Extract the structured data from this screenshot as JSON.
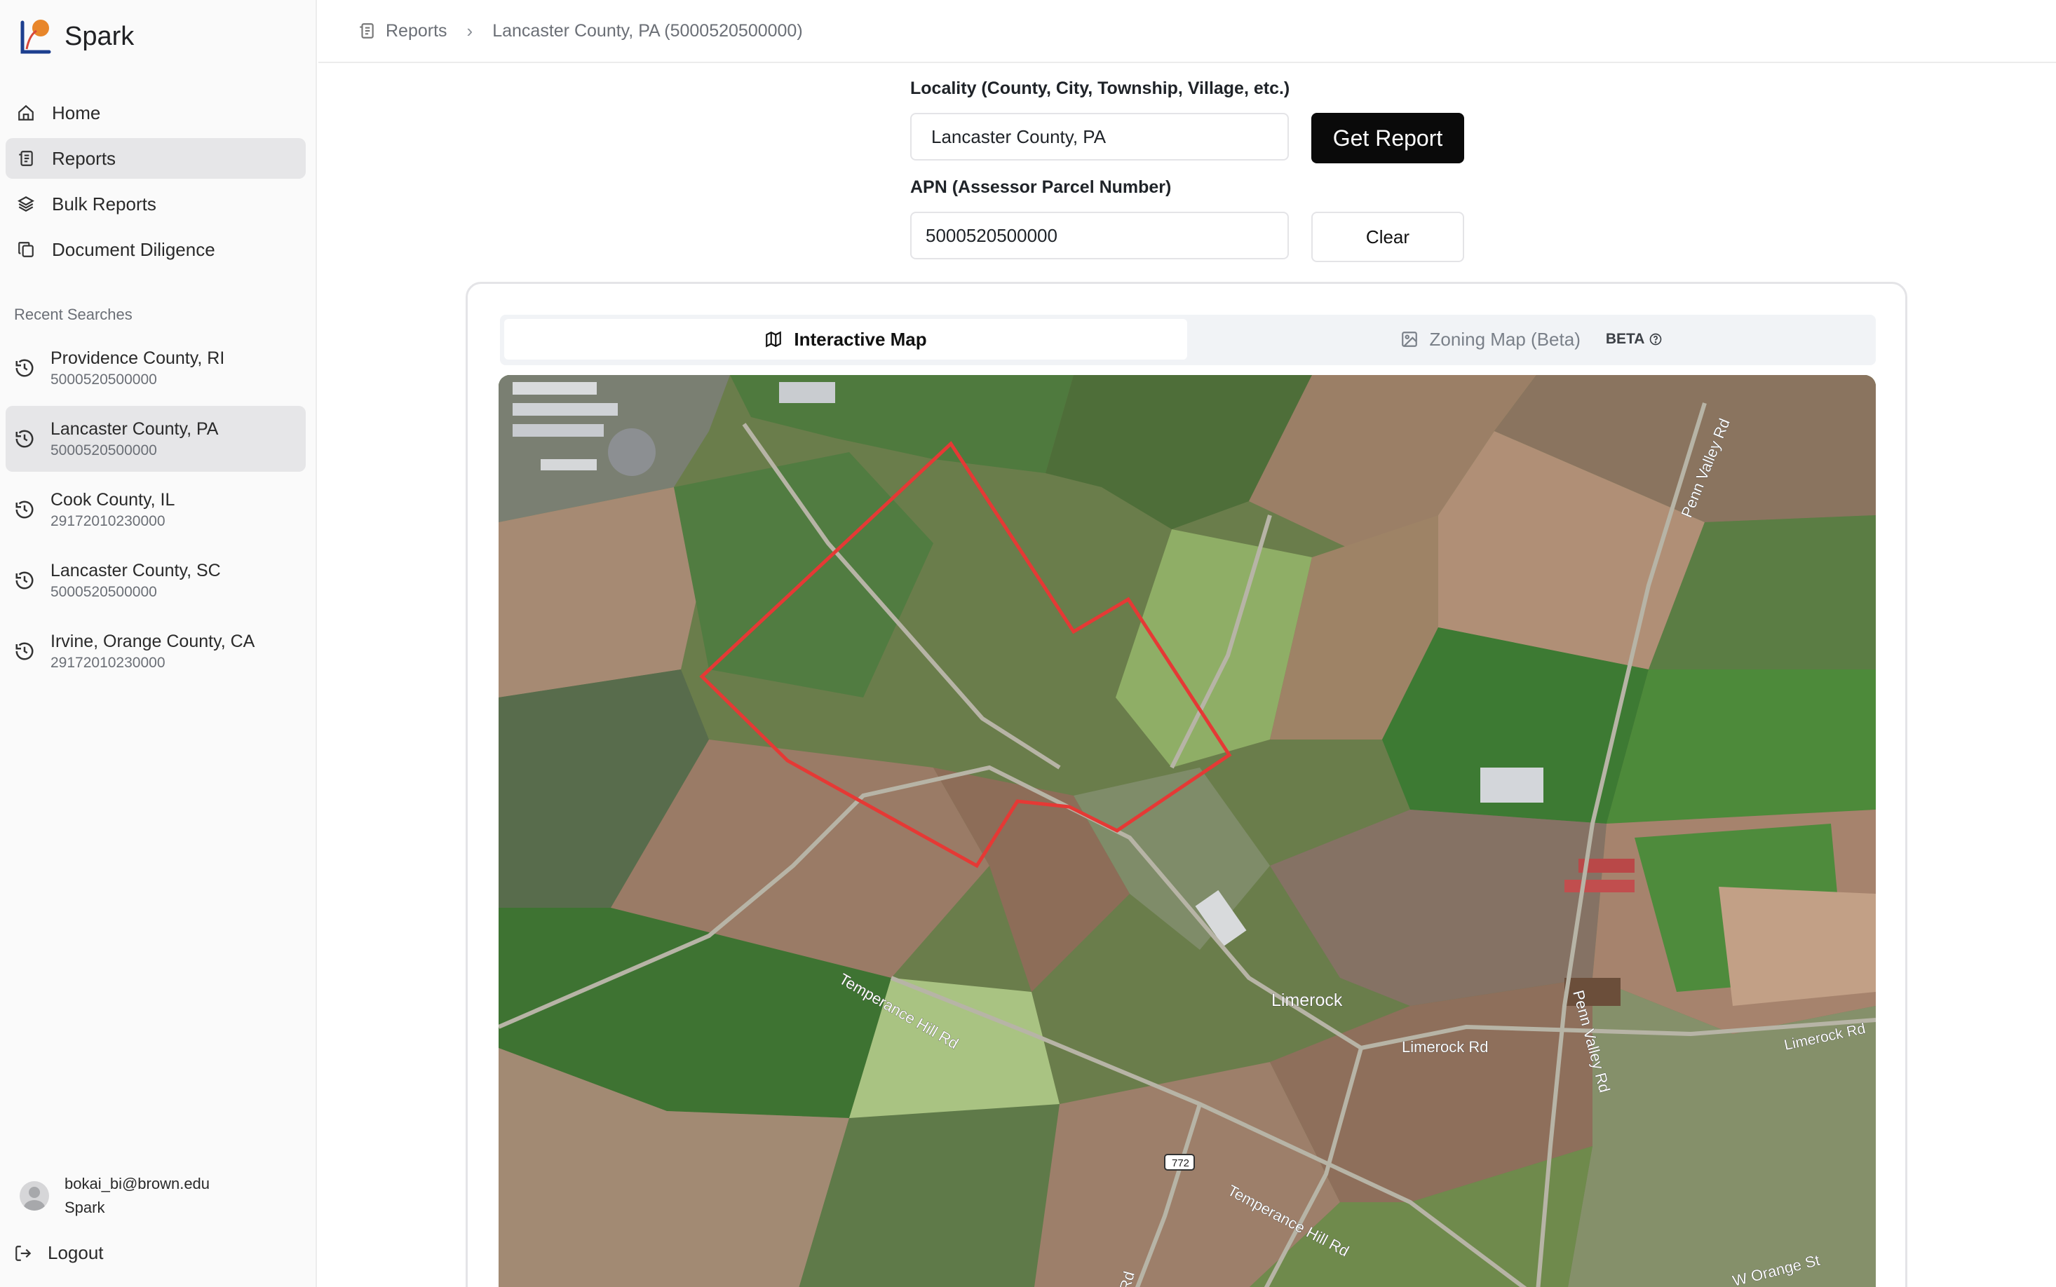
{
  "brand": {
    "name": "Spark"
  },
  "nav": [
    {
      "label": "Home",
      "icon": "home-icon",
      "active": false
    },
    {
      "label": "Reports",
      "icon": "reports-icon",
      "active": true
    },
    {
      "label": "Bulk Reports",
      "icon": "layers-icon",
      "active": false
    },
    {
      "label": "Document Diligence",
      "icon": "documents-icon",
      "active": false
    }
  ],
  "recent": {
    "title": "Recent Searches",
    "items": [
      {
        "name": "Providence County, RI",
        "apn": "5000520500000"
      },
      {
        "name": "Lancaster County, PA",
        "apn": "5000520500000"
      },
      {
        "name": "Cook County, IL",
        "apn": "29172010230000"
      },
      {
        "name": "Lancaster County, SC",
        "apn": "5000520500000"
      },
      {
        "name": "Irvine, Orange County, CA",
        "apn": "29172010230000"
      }
    ]
  },
  "user": {
    "email": "bokai_bi@brown.edu",
    "org": "Spark"
  },
  "logout_label": "Logout",
  "breadcrumb": {
    "root": "Reports",
    "current": "Lancaster County, PA (5000520500000)"
  },
  "form": {
    "locality_label": "Locality (County, City, Township, Village, etc.)",
    "locality_value": "Lancaster County, PA",
    "get_report_label": "Get Report",
    "apn_label": "APN (Assessor Parcel Number)",
    "apn_value": "5000520500000",
    "clear_label": "Clear"
  },
  "tabs": {
    "interactive": "Interactive Map",
    "zoning": "Zoning Map (Beta)",
    "beta_badge": "BETA"
  },
  "map": {
    "place_label": "Limerock",
    "roads": [
      "Penn Valley Rd",
      "Temperance Hill Rd",
      "Limerock Rd",
      "Limerock Rd",
      "Penn Valley Rd",
      "Temperance Hill Rd",
      "W Orange St",
      "n Rd"
    ],
    "shield": "772",
    "parcel_color": "#e53935"
  },
  "colors": {
    "primary": "#0a0a0a",
    "active_bg": "#e6e6e8"
  }
}
